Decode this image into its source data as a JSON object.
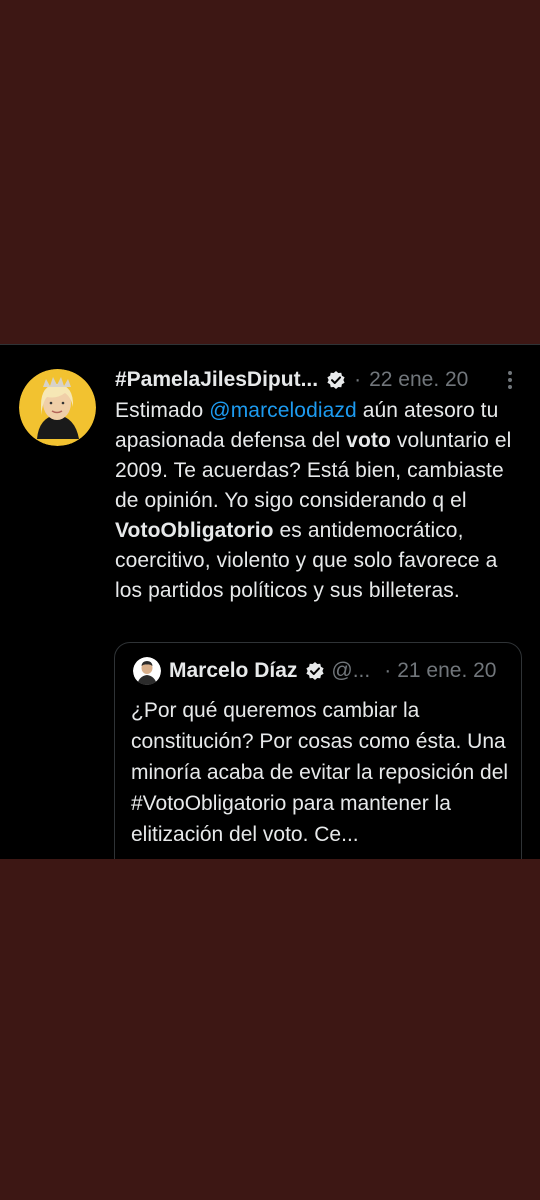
{
  "colors": {
    "background": "#3d1714",
    "tweet_background": "#000000",
    "text": "#e7e9ea",
    "muted": "#71767b",
    "link": "#1d9bf0",
    "border": "#2f3336"
  },
  "tweet": {
    "author_name": "#PamelaJilesDiput...",
    "separator": "·",
    "date": "22 ene. 20",
    "avatar_icon": "profile-photo-avatar",
    "more_icon": "more-vertical-icon",
    "verified_icon": "verified-badge-icon",
    "text": {
      "p1": "Estimado ",
      "mention": "@marcelodiazd",
      "p2": " aún atesoro tu apasionada defensa del ",
      "bold1": "voto",
      "p3": " voluntario el 2009. Te acuerdas? Está bien, cambiaste de opinión. Yo sigo considerando q el ",
      "bold2": "VotoObligatorio",
      "p4": " es antidemocrático, coercitivo, violento y que solo favorece a los partidos políticos y sus billeteras."
    }
  },
  "quoted_tweet": {
    "author_name": "Marcelo Díaz",
    "handle": "@...",
    "separator": "·",
    "date": "21 ene. 20",
    "text": "¿Por qué queremos cambiar la constitución? Por cosas como ésta. Una minoría acaba de evitar la reposición del #VotoObligatorio para mantener la elitización del voto. Ce..."
  }
}
